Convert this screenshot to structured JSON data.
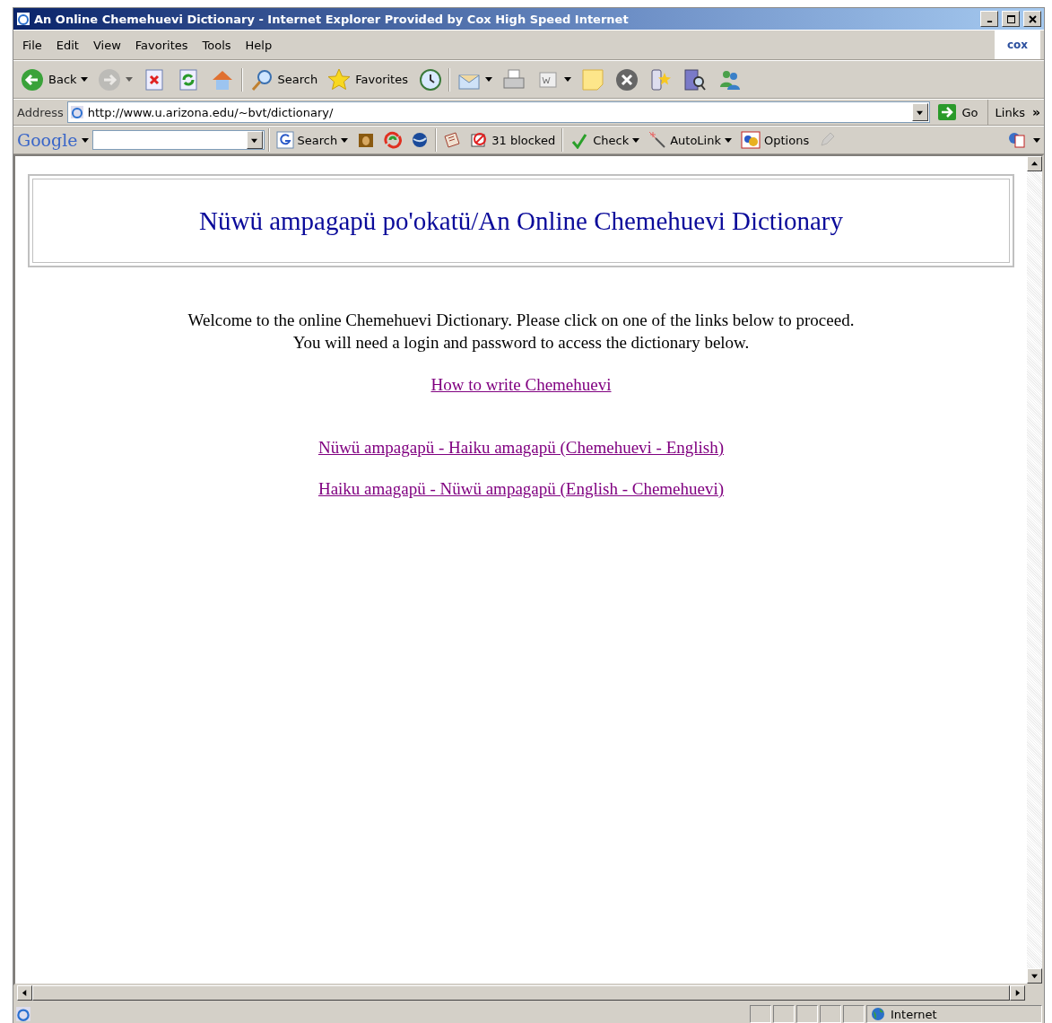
{
  "window": {
    "title": "An Online Chemehuevi Dictionary - Internet Explorer Provided by Cox High Speed Internet"
  },
  "menu": [
    "File",
    "Edit",
    "View",
    "Favorites",
    "Tools",
    "Help"
  ],
  "brand": "cox",
  "toolbar": [
    {
      "kind": "back",
      "label": "Back",
      "dropdown": true,
      "disabled": false
    },
    {
      "kind": "forward",
      "dropdown": true,
      "disabled": true
    },
    {
      "kind": "stop",
      "dropdown": false,
      "disabled": false
    },
    {
      "kind": "refresh",
      "dropdown": false,
      "disabled": false
    },
    {
      "kind": "home",
      "dropdown": false,
      "disabled": false
    },
    {
      "kind": "separator"
    },
    {
      "kind": "search",
      "label": "Search",
      "dropdown": false,
      "disabled": false
    },
    {
      "kind": "favorites",
      "label": "Favorites",
      "dropdown": false,
      "disabled": false
    },
    {
      "kind": "history",
      "dropdown": false,
      "disabled": false
    },
    {
      "kind": "separator"
    },
    {
      "kind": "mail",
      "dropdown": true,
      "disabled": false
    },
    {
      "kind": "print",
      "dropdown": false,
      "disabled": false
    },
    {
      "kind": "word",
      "dropdown": true,
      "disabled": false
    },
    {
      "kind": "note",
      "dropdown": false,
      "disabled": false
    },
    {
      "kind": "xcircle",
      "dropdown": false,
      "disabled": false
    },
    {
      "kind": "phonestar",
      "dropdown": false,
      "disabled": false
    },
    {
      "kind": "research",
      "dropdown": false,
      "disabled": false
    },
    {
      "kind": "messenger",
      "dropdown": false,
      "disabled": false
    }
  ],
  "address": {
    "label": "Address",
    "url": "http://www.u.arizona.edu/~bvt/dictionary/",
    "go": "Go",
    "links": "Links",
    "more": "»"
  },
  "google_bar": {
    "logo": "Google",
    "items": [
      {
        "kind": "gsearch",
        "label": "Search",
        "dropdown": true,
        "disabled": false
      },
      {
        "kind": "picture",
        "dropdown": false,
        "disabled": false
      },
      {
        "kind": "swirl",
        "dropdown": false,
        "disabled": false
      },
      {
        "kind": "globe",
        "dropdown": false,
        "disabled": false
      },
      {
        "kind": "separator"
      },
      {
        "kind": "news",
        "dropdown": false,
        "disabled": false
      },
      {
        "kind": "blocked",
        "label": "31 blocked",
        "dropdown": false,
        "disabled": false
      },
      {
        "kind": "separator"
      },
      {
        "kind": "spell",
        "label": "Check",
        "dropdown": true,
        "disabled": false
      },
      {
        "kind": "wand",
        "label": "AutoLink",
        "dropdown": true,
        "disabled": false
      },
      {
        "kind": "options",
        "label": "Options",
        "dropdown": false,
        "disabled": false
      },
      {
        "kind": "pencil",
        "dropdown": false,
        "disabled": true
      }
    ]
  },
  "page": {
    "heading": "Nüwü ampagapü po'okatü/An Online Chemehuevi Dictionary",
    "intro": [
      "Welcome to the online Chemehuevi Dictionary. Please click on one of the links below to proceed.",
      "You will need a login and password to access the dictionary below."
    ],
    "links": [
      "How to write Chemehuevi",
      "Nüwü ampagapü - Haiku amagapü (Chemehuevi - English)",
      "Haiku amagapü - Nüwü ampagapü (English - Chemehuevi)"
    ]
  },
  "status_bar": {
    "zone": "Internet"
  }
}
